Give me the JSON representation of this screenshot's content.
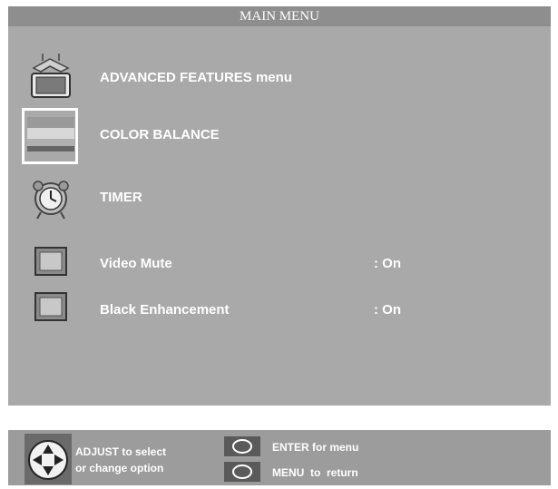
{
  "window": {
    "title": "MAIN MENU"
  },
  "menu": {
    "items": [
      {
        "label": "ADVANCED FEATURES menu",
        "icon": "tv-antenna-icon",
        "value": ""
      },
      {
        "label": "COLOR BALANCE",
        "icon": "color-balance-icon",
        "value": "",
        "selected": true
      },
      {
        "label": "TIMER",
        "icon": "alarm-clock-icon",
        "value": ""
      },
      {
        "label": "Video Mute",
        "icon": "square-button-icon",
        "value": ": On"
      },
      {
        "label": "Black Enhancement",
        "icon": "square-button-icon",
        "value": ": On"
      }
    ]
  },
  "footer": {
    "adjust_line1": "ADJUST to select",
    "adjust_line2": "or change option",
    "enter_label": "ENTER for menu",
    "menu_label": "MENU  to  return",
    "dpad_icon": "dpad-icon",
    "button_icon": "oval-button-icon"
  },
  "colors": {
    "panel": "#a9a9a9",
    "title_bar": "#8e8e8e",
    "text": "#ffffff",
    "footer": "#9c9c9c"
  }
}
